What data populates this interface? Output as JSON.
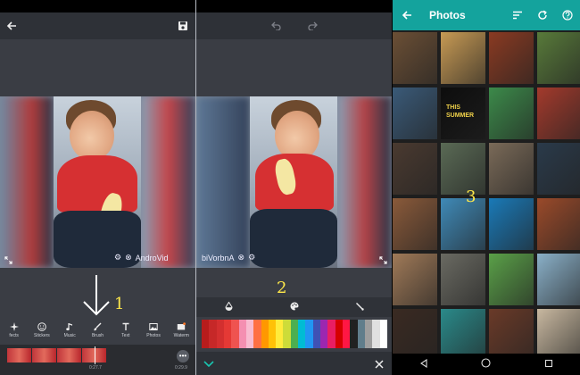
{
  "editor": {
    "tools": [
      {
        "icon": "sparkle-icon",
        "label": "fects"
      },
      {
        "icon": "smiley-icon",
        "label": "Stickers"
      },
      {
        "icon": "music-note-icon",
        "label": "Music"
      },
      {
        "icon": "brush-icon",
        "label": "Brush"
      },
      {
        "icon": "text-icon",
        "label": "Text"
      },
      {
        "icon": "photos-icon",
        "label": "Photos"
      },
      {
        "icon": "watermark-icon",
        "label": "Waterm"
      }
    ],
    "watermark": "AndroVid",
    "timeline_time": "0:27.7",
    "timeline_end": "0:29.9",
    "annotation": "1"
  },
  "brush": {
    "watermark_mirrored": "biVorbnA",
    "annotation": "2",
    "buttons": [
      "drop-icon",
      "palette-icon",
      "line-width-icon"
    ],
    "palette_colors": [
      "#b71c1c",
      "#c62828",
      "#d32f2f",
      "#e53935",
      "#ef5350",
      "#f48fb1",
      "#f8bbd0",
      "#ff7043",
      "#ff9800",
      "#ffc107",
      "#ffeb3b",
      "#cddc39",
      "#4caf50",
      "#00bcd4",
      "#2196f3",
      "#3f51b5",
      "#9c27b0",
      "#e91e63",
      "#d50000",
      "#ff1744",
      "#212121",
      "#607d8b",
      "#9e9e9e",
      "#e0e0e0",
      "#ffffff"
    ]
  },
  "photos": {
    "title": "Photos",
    "annotation": "3",
    "summer_text": "THIS SUMMER",
    "grid_colors": [
      [
        "#6b4f35",
        "#c79a54",
        "#8a3a22",
        "#587a3a"
      ],
      [
        "#3a5a78",
        "#0d0d0d",
        "#3c8a4a",
        "#a33a2c"
      ],
      [
        "#4a3a30",
        "#5a6a55",
        "#7a6a58",
        "#2a3a4a"
      ],
      [
        "#8a5a3a",
        "#3f8ab8",
        "#1a7ab8",
        "#9a4a2a"
      ],
      [
        "#a07a58",
        "#6a6a62",
        "#5aa048",
        "#8ab0c8"
      ],
      [
        "#3a2a22",
        "#2a8a8a",
        "#6a3a28",
        "#c8b8a0"
      ]
    ]
  }
}
